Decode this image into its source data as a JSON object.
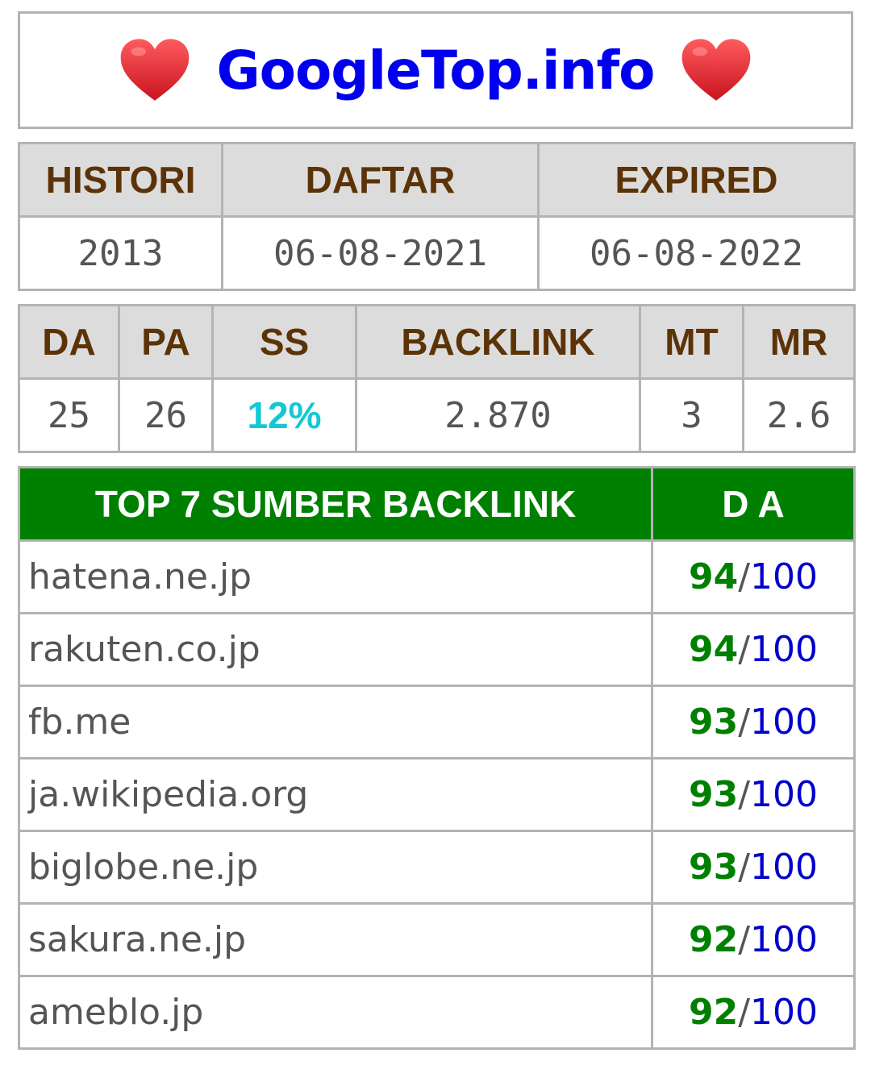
{
  "header": {
    "title": "GoogleTop.info",
    "left_icon": "heart-icon",
    "right_icon": "heart-icon",
    "heart_color": "#e0232d"
  },
  "history": {
    "columns": [
      "HISTORI",
      "DAFTAR",
      "EXPIRED"
    ],
    "values": [
      "2013",
      "06-08-2021",
      "06-08-2022"
    ]
  },
  "stats": {
    "columns": [
      "DA",
      "PA",
      "SS",
      "BACKLINK",
      "MT",
      "MR"
    ],
    "values": [
      "25",
      "26",
      "12%",
      "2.870",
      "3",
      "2.6"
    ]
  },
  "top_sources": {
    "header_source": "TOP 7 SUMBER BACKLINK",
    "header_da": "D A",
    "separator": "/",
    "max": "100",
    "rows": [
      {
        "site": "hatena.ne.jp",
        "da": "94"
      },
      {
        "site": "rakuten.co.jp",
        "da": "94"
      },
      {
        "site": "fb.me",
        "da": "93"
      },
      {
        "site": "ja.wikipedia.org",
        "da": "93"
      },
      {
        "site": "biglobe.ne.jp",
        "da": "93"
      },
      {
        "site": "sakura.ne.jp",
        "da": "92"
      },
      {
        "site": "ameblo.jp",
        "da": "92"
      }
    ]
  },
  "colors": {
    "title": "#0000ee",
    "header_text": "#5c3307",
    "header_bg": "#dcdcdc",
    "ss_value": "#13c8d4",
    "top_header_bg": "#008000",
    "da_value": "#008000",
    "da_max": "#0000cc"
  }
}
